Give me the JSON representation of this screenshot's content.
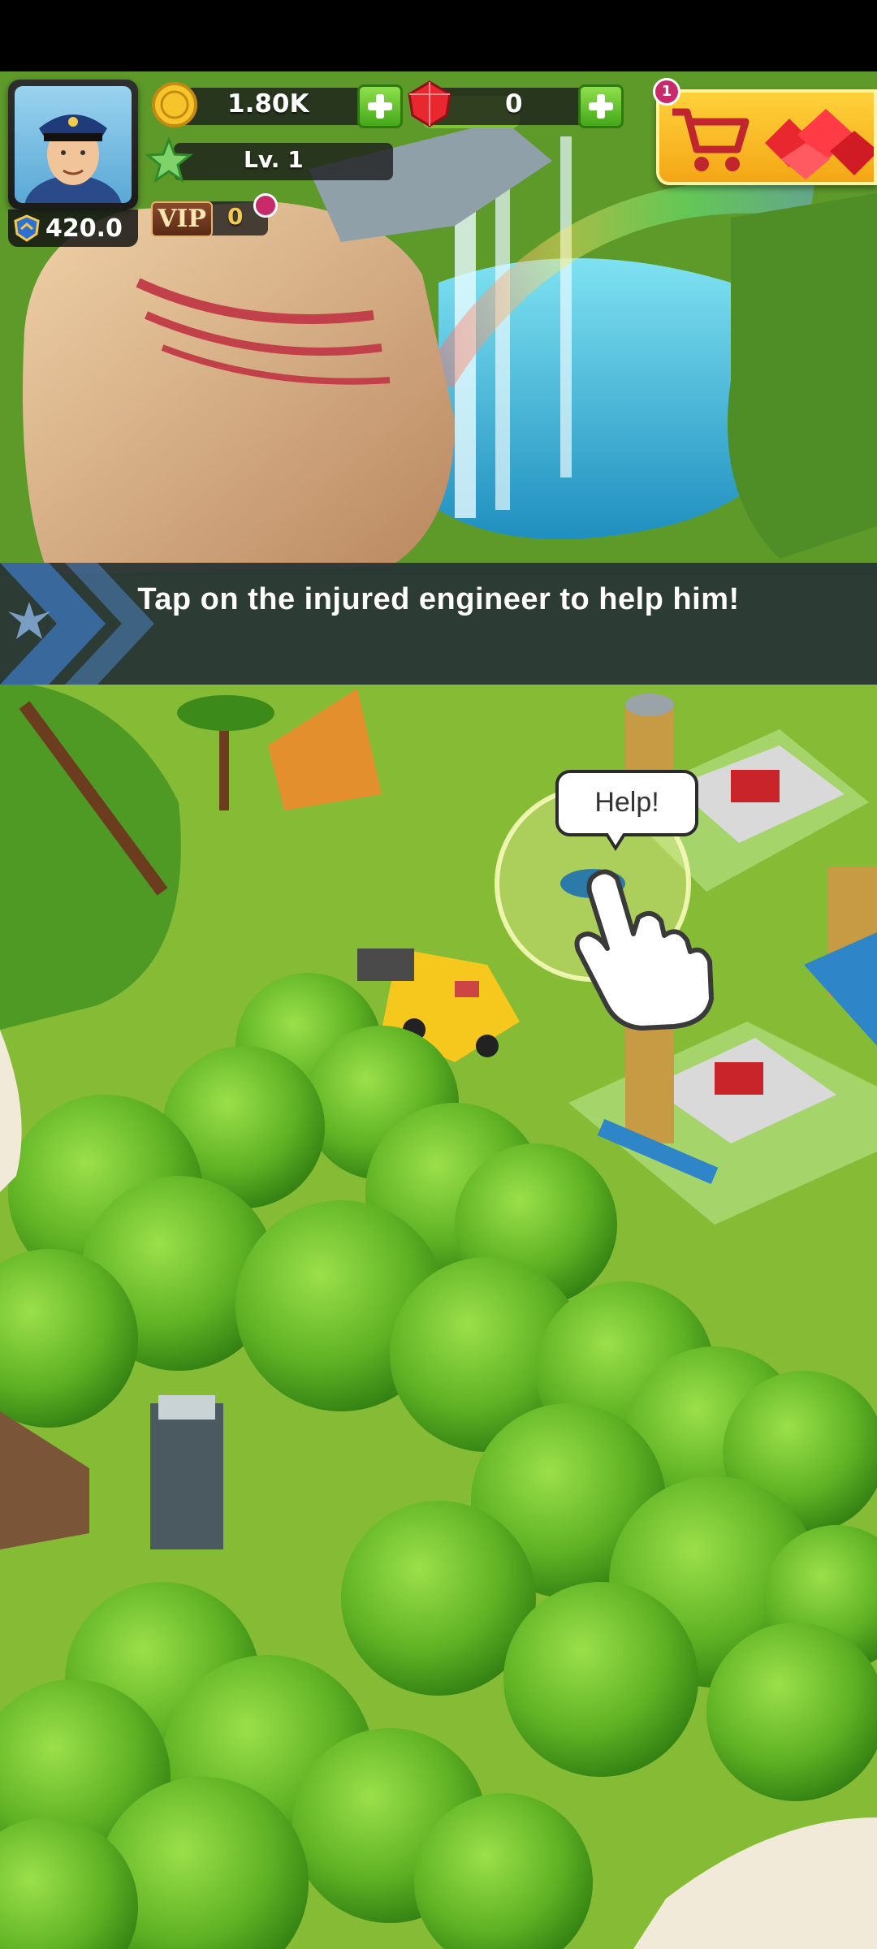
{
  "hud": {
    "power": "420.0",
    "coins": "1.80K",
    "gems": "0",
    "level": "Lv. 1",
    "vip_label": "VIP",
    "vip_points": "0",
    "shop_notification_count": "1"
  },
  "tutorial": {
    "instruction": "Tap on the injured engineer to help him!"
  },
  "bubble": {
    "text": "Help!"
  },
  "icons": {
    "coin": "coin-icon",
    "gem": "gem-icon",
    "level_star": "star-icon",
    "shop": "shopping-cart-icon",
    "plus": "plus-icon",
    "power_badge": "shield-rank-icon",
    "pointer": "tap-hand-icon"
  },
  "colors": {
    "plus_green": "#45a81a",
    "shop_yellow": "#f4a616",
    "notify_magenta": "#c92a6a",
    "grass": "#7fb531",
    "banner": "#263234"
  }
}
